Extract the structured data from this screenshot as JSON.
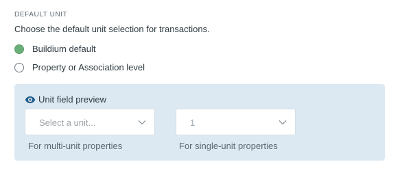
{
  "section": {
    "title": "DEFAULT UNIT",
    "description": "Choose the default unit selection for transactions."
  },
  "options": [
    {
      "label": "Buildium default",
      "checked": true
    },
    {
      "label": "Property or Association level",
      "checked": false
    }
  ],
  "preview": {
    "title": "Unit field preview",
    "icon": "eye-icon",
    "multi_unit": {
      "placeholder": "Select a unit...",
      "helper": "For multi-unit properties"
    },
    "single_unit": {
      "value": "1",
      "helper": "For single-unit properties"
    }
  },
  "colors": {
    "radio_checked": "#6aaf78",
    "panel_background": "#dde9f2",
    "eye_icon": "#1f5e8c"
  }
}
